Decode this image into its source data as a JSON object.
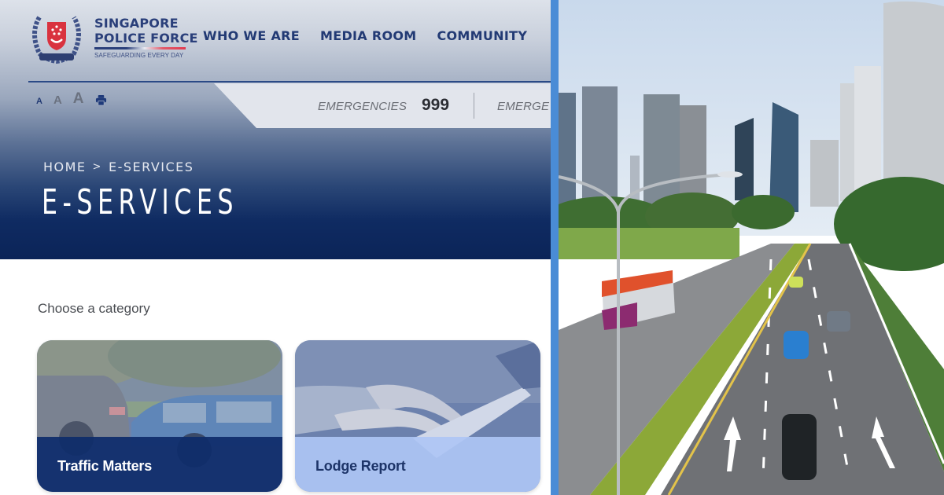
{
  "site": {
    "brand_line1": "SINGAPORE",
    "brand_line2": "POLICE FORCE",
    "tagline": "SAFEGUARDING EVERY DAY",
    "logo_icon": "police-crest-icon"
  },
  "nav": {
    "items": [
      {
        "label": "WHO WE ARE"
      },
      {
        "label": "MEDIA ROOM"
      },
      {
        "label": "COMMUNITY"
      }
    ]
  },
  "accessibility": {
    "font_small": "A",
    "font_medium": "A",
    "font_large": "A",
    "print_icon": "printer-icon"
  },
  "emergency": {
    "label": "EMERGENCIES",
    "number": "999",
    "second_label": "EMERGE"
  },
  "breadcrumb": {
    "home": "HOME",
    "separator": ">",
    "current": "E-SERVICES"
  },
  "page": {
    "title": "E-SERVICES",
    "prompt": "Choose a category"
  },
  "categories": [
    {
      "label": "Traffic Matters",
      "image": "car-collision-photo"
    },
    {
      "label": "Lodge Report",
      "image": "typing-on-laptop-photo"
    }
  ],
  "right_image": {
    "subject": "singapore-road-skyline-photo"
  },
  "colors": {
    "brand_navy": "#223a74",
    "hero_dark": "#0b2458",
    "divider_blue": "#4a8cd6",
    "traffic_overlay": "#0e2c6a",
    "lodge_overlay": "#aec6f4",
    "brand_red": "#e23b4f"
  }
}
